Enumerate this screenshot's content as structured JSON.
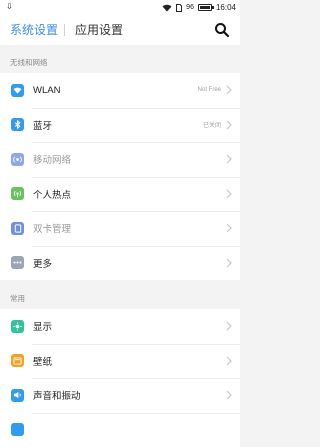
{
  "status_bar": {
    "left_icon": "download-icon",
    "battery_level": "96",
    "time": "16:04",
    "icons": [
      "wifi-icon",
      "sim-icon",
      "battery-icon"
    ]
  },
  "header": {
    "tab_active": "系统设置",
    "tab_inactive": "应用设置",
    "search_icon": "search-icon"
  },
  "sections": {
    "wireless": "无线和网络",
    "common": "常用"
  },
  "wireless_items": [
    {
      "label": "WLAN",
      "value": "Not Free",
      "icon": "wifi-icon",
      "color": "#2f9bf2"
    },
    {
      "label": "蓝牙",
      "value": "已关闭",
      "icon": "bluetooth-icon",
      "color": "#2f9bf2"
    },
    {
      "label": "移动网络",
      "value": "",
      "icon": "mobile-network-icon",
      "color": "#8aa9e6"
    },
    {
      "label": "个人热点",
      "value": "",
      "icon": "hotspot-icon",
      "color": "#65c45a"
    },
    {
      "label": "双卡管理",
      "value": "",
      "icon": "dual-sim-icon",
      "color": "#6f91e0"
    },
    {
      "label": "更多",
      "value": "",
      "icon": "more-icon",
      "color": "#9aa6b6"
    }
  ],
  "common_items": [
    {
      "label": "显示",
      "icon": "display-icon",
      "color": "#2fc59c"
    },
    {
      "label": "壁纸",
      "icon": "wallpaper-icon",
      "color": "#f3a320"
    },
    {
      "label": "声音和振动",
      "icon": "sound-icon",
      "color": "#2f9bf2"
    }
  ],
  "colors": {
    "accent": "#3c8ee8",
    "chevron": "#c7c7c7"
  }
}
